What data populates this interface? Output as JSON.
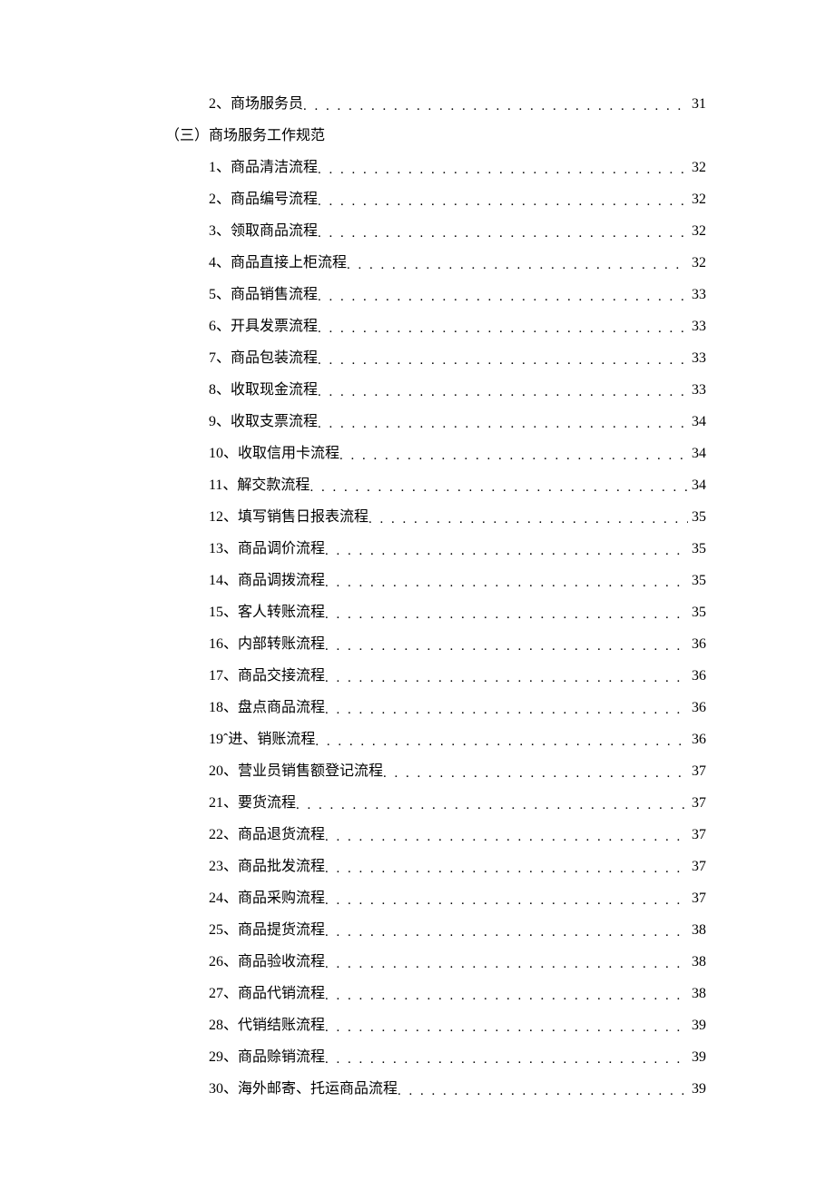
{
  "toc": {
    "preEntries": [
      {
        "num": "2",
        "sep": "、",
        "label": "商场服务员",
        "page": "31"
      }
    ],
    "section": {
      "prefix": "（三）",
      "title": "商场服务工作规范"
    },
    "entries": [
      {
        "num": "1",
        "sep": "、",
        "label": "商品清洁流程",
        "page": "32"
      },
      {
        "num": "2",
        "sep": "、",
        "label": "商品编号流程",
        "page": "32"
      },
      {
        "num": "3",
        "sep": "、",
        "label": "领取商品流程",
        "page": "32"
      },
      {
        "num": "4",
        "sep": "、",
        "label": "商品直接上柜流程",
        "page": "32"
      },
      {
        "num": "5",
        "sep": "、",
        "label": "商品销售流程",
        "page": "33"
      },
      {
        "num": "6",
        "sep": "、",
        "label": "开具发票流程",
        "page": "33"
      },
      {
        "num": "7",
        "sep": "、",
        "label": "商品包装流程",
        "page": "33"
      },
      {
        "num": "8",
        "sep": "、",
        "label": "收取现金流程",
        "page": "33"
      },
      {
        "num": "9",
        "sep": "、",
        "label": "收取支票流程",
        "page": "34"
      },
      {
        "num": "10",
        "sep": "、",
        "label": "收取信用卡流程",
        "page": "34"
      },
      {
        "num": "11",
        "sep": "、",
        "label": "解交款流程",
        "page": "34"
      },
      {
        "num": "12",
        "sep": "、",
        "label": "填写销售日报表流程",
        "page": "35"
      },
      {
        "num": "13",
        "sep": "、",
        "label": "商品调价流程",
        "page": "35"
      },
      {
        "num": "14",
        "sep": "、",
        "label": "商品调拨流程",
        "page": "35"
      },
      {
        "num": "15",
        "sep": "、",
        "label": "客人转账流程",
        "page": "35"
      },
      {
        "num": "16",
        "sep": "、",
        "label": "内部转账流程",
        "page": "36"
      },
      {
        "num": "17",
        "sep": "、",
        "label": "商品交接流程",
        "page": "36"
      },
      {
        "num": "18",
        "sep": "、",
        "label": "盘点商品流程",
        "page": "36"
      },
      {
        "num": "19ˆ",
        "sep": "",
        "label": "进、销账流程",
        "page": "36"
      },
      {
        "num": "20",
        "sep": "、",
        "label": "营业员销售额登记流程",
        "page": "37"
      },
      {
        "num": "21",
        "sep": "、",
        "label": "要货流程",
        "page": "37"
      },
      {
        "num": "22",
        "sep": "、",
        "label": "商品退货流程",
        "page": "37"
      },
      {
        "num": "23",
        "sep": "、",
        "label": "商品批发流程",
        "page": "37"
      },
      {
        "num": "24",
        "sep": "、",
        "label": "商品采购流程",
        "page": "37"
      },
      {
        "num": "25",
        "sep": "、",
        "label": "商品提货流程",
        "page": "38"
      },
      {
        "num": "26",
        "sep": "、",
        "label": "商品验收流程",
        "page": "38"
      },
      {
        "num": "27",
        "sep": "、",
        "label": "商品代销流程",
        "page": "38"
      },
      {
        "num": "28",
        "sep": "、",
        "label": "代销结账流程",
        "page": "39"
      },
      {
        "num": "29",
        "sep": "、",
        "label": "商品赊销流程",
        "page": "39"
      },
      {
        "num": "30",
        "sep": "、",
        "label": "海外邮寄、托运商品流程",
        "page": "39"
      }
    ]
  }
}
